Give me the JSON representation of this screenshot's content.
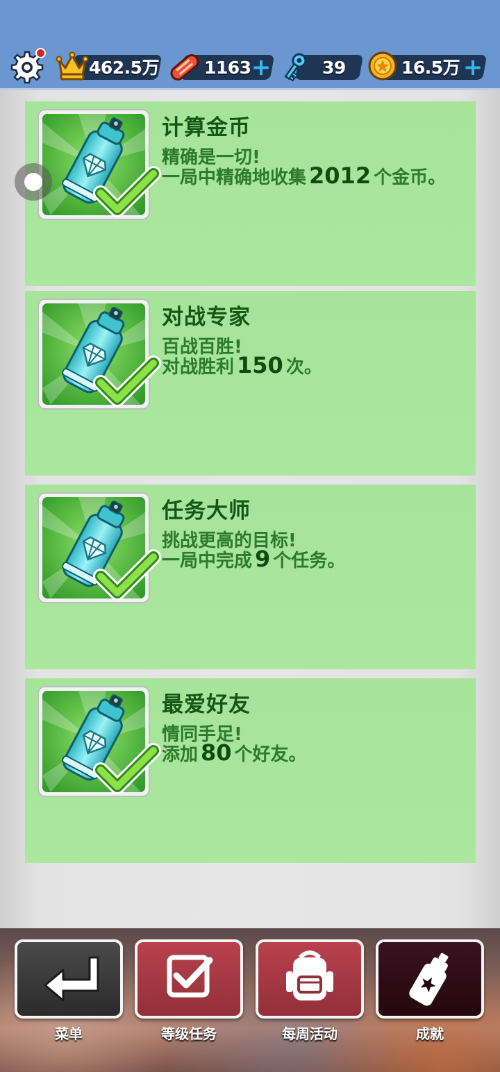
{
  "header": {
    "settings_icon": "gear-icon",
    "notification_color": "#d42626",
    "crown_score": "462.5万",
    "hoverboards": "1163",
    "keys": "39",
    "coins": "16.5万",
    "plus_symbol": "+"
  },
  "achievements": [
    {
      "title": "计算金币",
      "subtitle": "精确是一切!",
      "desc_prefix": "一局中精确地收集",
      "count": "2012",
      "desc_suffix": "个金币。",
      "completed": true,
      "icon": "spray-can-diamond-icon"
    },
    {
      "title": "对战专家",
      "subtitle": "百战百胜!",
      "desc_prefix": "对战胜利",
      "count": "150",
      "desc_suffix": "次。",
      "completed": true,
      "icon": "spray-can-diamond-icon"
    },
    {
      "title": "任务大师",
      "subtitle": "挑战更高的目标!",
      "desc_prefix": "一局中完成",
      "count": "9",
      "desc_suffix": "个任务。",
      "completed": true,
      "icon": "spray-can-diamond-icon"
    },
    {
      "title": "最爱好友",
      "subtitle": "情同手足!",
      "desc_prefix": "添加",
      "count": "80",
      "desc_suffix": "个好友。",
      "completed": true,
      "icon": "spray-can-diamond-icon"
    }
  ],
  "nav": [
    {
      "label": "菜单",
      "icon": "return-arrow-icon"
    },
    {
      "label": "等级任务",
      "icon": "checkbox-icon"
    },
    {
      "label": "每周活动",
      "icon": "backpack-icon"
    },
    {
      "label": "成就",
      "icon": "spray-can-star-icon",
      "active": true
    }
  ],
  "colors": {
    "header_bg": "#6a97cf",
    "card_bg": "#a6e49a",
    "title_text": "#125712",
    "accent_plus": "#36b6f4"
  }
}
